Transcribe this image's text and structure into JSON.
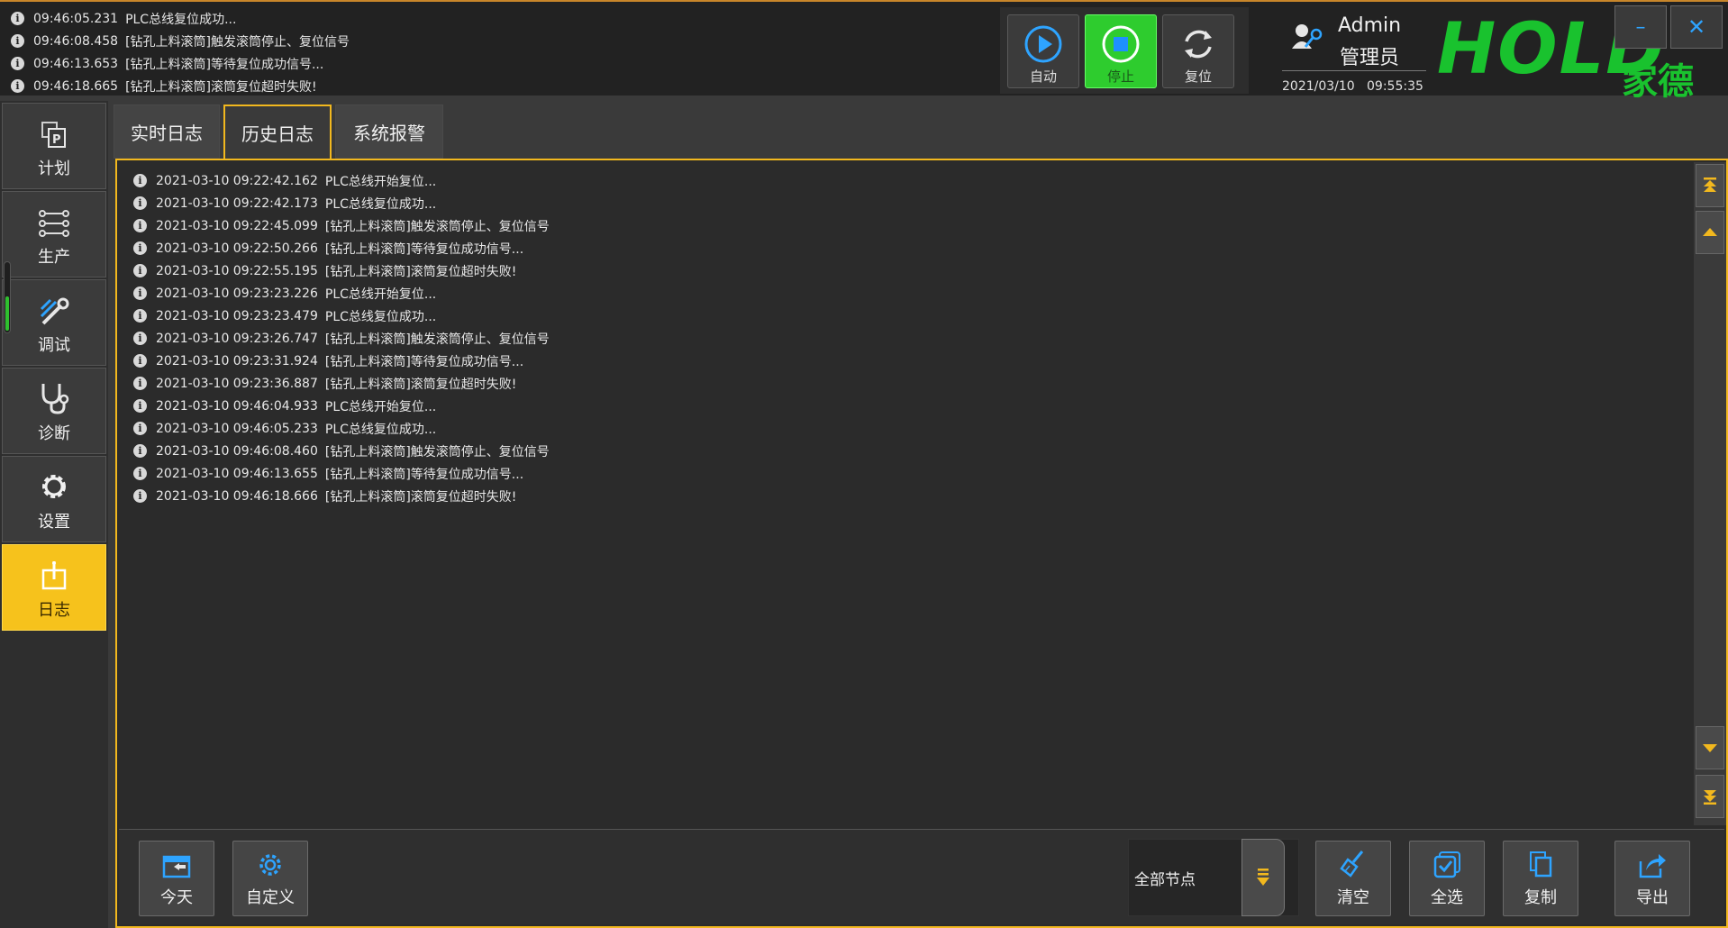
{
  "recent_log": [
    {
      "time": "09:46:05.231",
      "message": "PLC总线复位成功..."
    },
    {
      "time": "09:46:08.458",
      "message": "[钻孔上料滚筒]触发滚筒停止、复位信号"
    },
    {
      "time": "09:46:13.653",
      "message": "[钻孔上料滚筒]等待复位成功信号..."
    },
    {
      "time": "09:46:18.665",
      "message": "[钻孔上料滚筒]滚筒复位超时失败!"
    }
  ],
  "controls": {
    "auto": "自动",
    "stop": "停止",
    "reset": "复位"
  },
  "user": {
    "name": "Admin",
    "role": "管理员",
    "date": "2021/03/10",
    "time": "09:55:35"
  },
  "logo": {
    "text": "HOLD",
    "cn": "家德"
  },
  "window": {
    "minimize": "–",
    "close": "✕"
  },
  "nav": [
    {
      "label": "计划",
      "icon": "plan-icon"
    },
    {
      "label": "生产",
      "icon": "production-icon"
    },
    {
      "label": "调试",
      "icon": "debug-icon"
    },
    {
      "label": "诊断",
      "icon": "diagnose-icon"
    },
    {
      "label": "设置",
      "icon": "settings-icon"
    },
    {
      "label": "日志",
      "icon": "log-icon",
      "active": true
    }
  ],
  "tabs": [
    {
      "label": "实时日志"
    },
    {
      "label": "历史日志",
      "active": true
    },
    {
      "label": "系统报警"
    }
  ],
  "history_log": [
    {
      "time": "2021-03-10 09:22:42.162",
      "message": "PLC总线开始复位..."
    },
    {
      "time": "2021-03-10 09:22:42.173",
      "message": "PLC总线复位成功..."
    },
    {
      "time": "2021-03-10 09:22:45.099",
      "message": "[钻孔上料滚筒]触发滚筒停止、复位信号"
    },
    {
      "time": "2021-03-10 09:22:50.266",
      "message": "[钻孔上料滚筒]等待复位成功信号..."
    },
    {
      "time": "2021-03-10 09:22:55.195",
      "message": "[钻孔上料滚筒]滚筒复位超时失败!"
    },
    {
      "time": "2021-03-10 09:23:23.226",
      "message": "PLC总线开始复位..."
    },
    {
      "time": "2021-03-10 09:23:23.479",
      "message": "PLC总线复位成功..."
    },
    {
      "time": "2021-03-10 09:23:26.747",
      "message": "[钻孔上料滚筒]触发滚筒停止、复位信号"
    },
    {
      "time": "2021-03-10 09:23:31.924",
      "message": "[钻孔上料滚筒]等待复位成功信号..."
    },
    {
      "time": "2021-03-10 09:23:36.887",
      "message": "[钻孔上料滚筒]滚筒复位超时失败!"
    },
    {
      "time": "2021-03-10 09:46:04.933",
      "message": "PLC总线开始复位..."
    },
    {
      "time": "2021-03-10 09:46:05.233",
      "message": "PLC总线复位成功..."
    },
    {
      "time": "2021-03-10 09:46:08.460",
      "message": "[钻孔上料滚筒]触发滚筒停止、复位信号"
    },
    {
      "time": "2021-03-10 09:46:13.655",
      "message": "[钻孔上料滚筒]等待复位成功信号..."
    },
    {
      "time": "2021-03-10 09:46:18.666",
      "message": "[钻孔上料滚筒]滚筒复位超时失败!"
    }
  ],
  "bottom": {
    "today": "今天",
    "custom": "自定义",
    "node_select": "全部节点",
    "clear": "清空",
    "select_all": "全选",
    "copy": "复制",
    "export": "导出"
  },
  "colors": {
    "accent": "#f2b81e",
    "active_green": "#2ecc2e",
    "logo_green": "#19c22e",
    "icon_blue": "#2ea4ff"
  }
}
